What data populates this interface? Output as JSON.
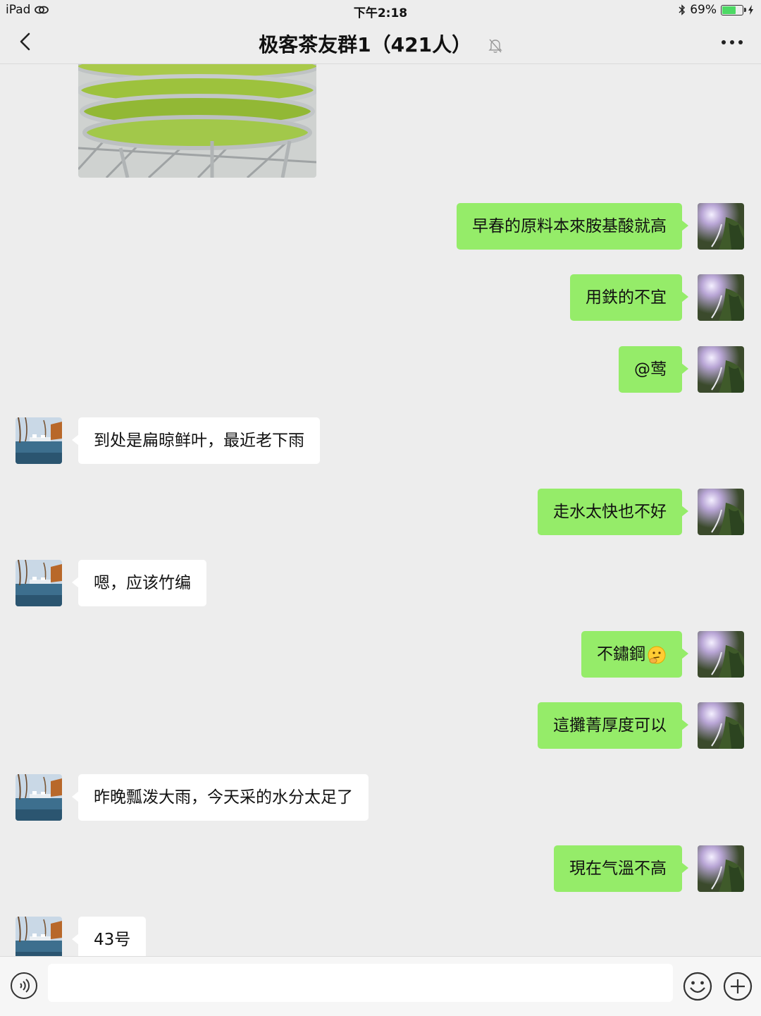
{
  "status_bar": {
    "device": "iPad",
    "time": "下午2:18",
    "battery": "69%",
    "battery_level": 0.69
  },
  "nav": {
    "title": "极客茶友群1（421人）"
  },
  "messages": [
    {
      "side": "right",
      "text": "早春的原料本來胺基酸就高"
    },
    {
      "side": "right",
      "text": "用鉄的不宜"
    },
    {
      "side": "right",
      "text": "@莺"
    },
    {
      "side": "left",
      "text": "到处是扁晾鲜叶，最近老下雨"
    },
    {
      "side": "right",
      "text": "走水太快也不好"
    },
    {
      "side": "left",
      "text": "嗯，应该竹编"
    },
    {
      "side": "right",
      "text": "不鏽鋼",
      "emoji": "thinking-face-emoji"
    },
    {
      "side": "right",
      "text": "這攤菁厚度可以"
    },
    {
      "side": "left",
      "text": "昨晚瓢泼大雨，今天采的水分太足了"
    },
    {
      "side": "right",
      "text": "現在气溫不高"
    },
    {
      "side": "left",
      "text": "43号"
    }
  ],
  "input": {
    "value": "",
    "placeholder": ""
  },
  "colors": {
    "background": "#ededed",
    "sent_bubble": "#95ec69",
    "received_bubble": "#ffffff",
    "battery": "#4cd964"
  }
}
